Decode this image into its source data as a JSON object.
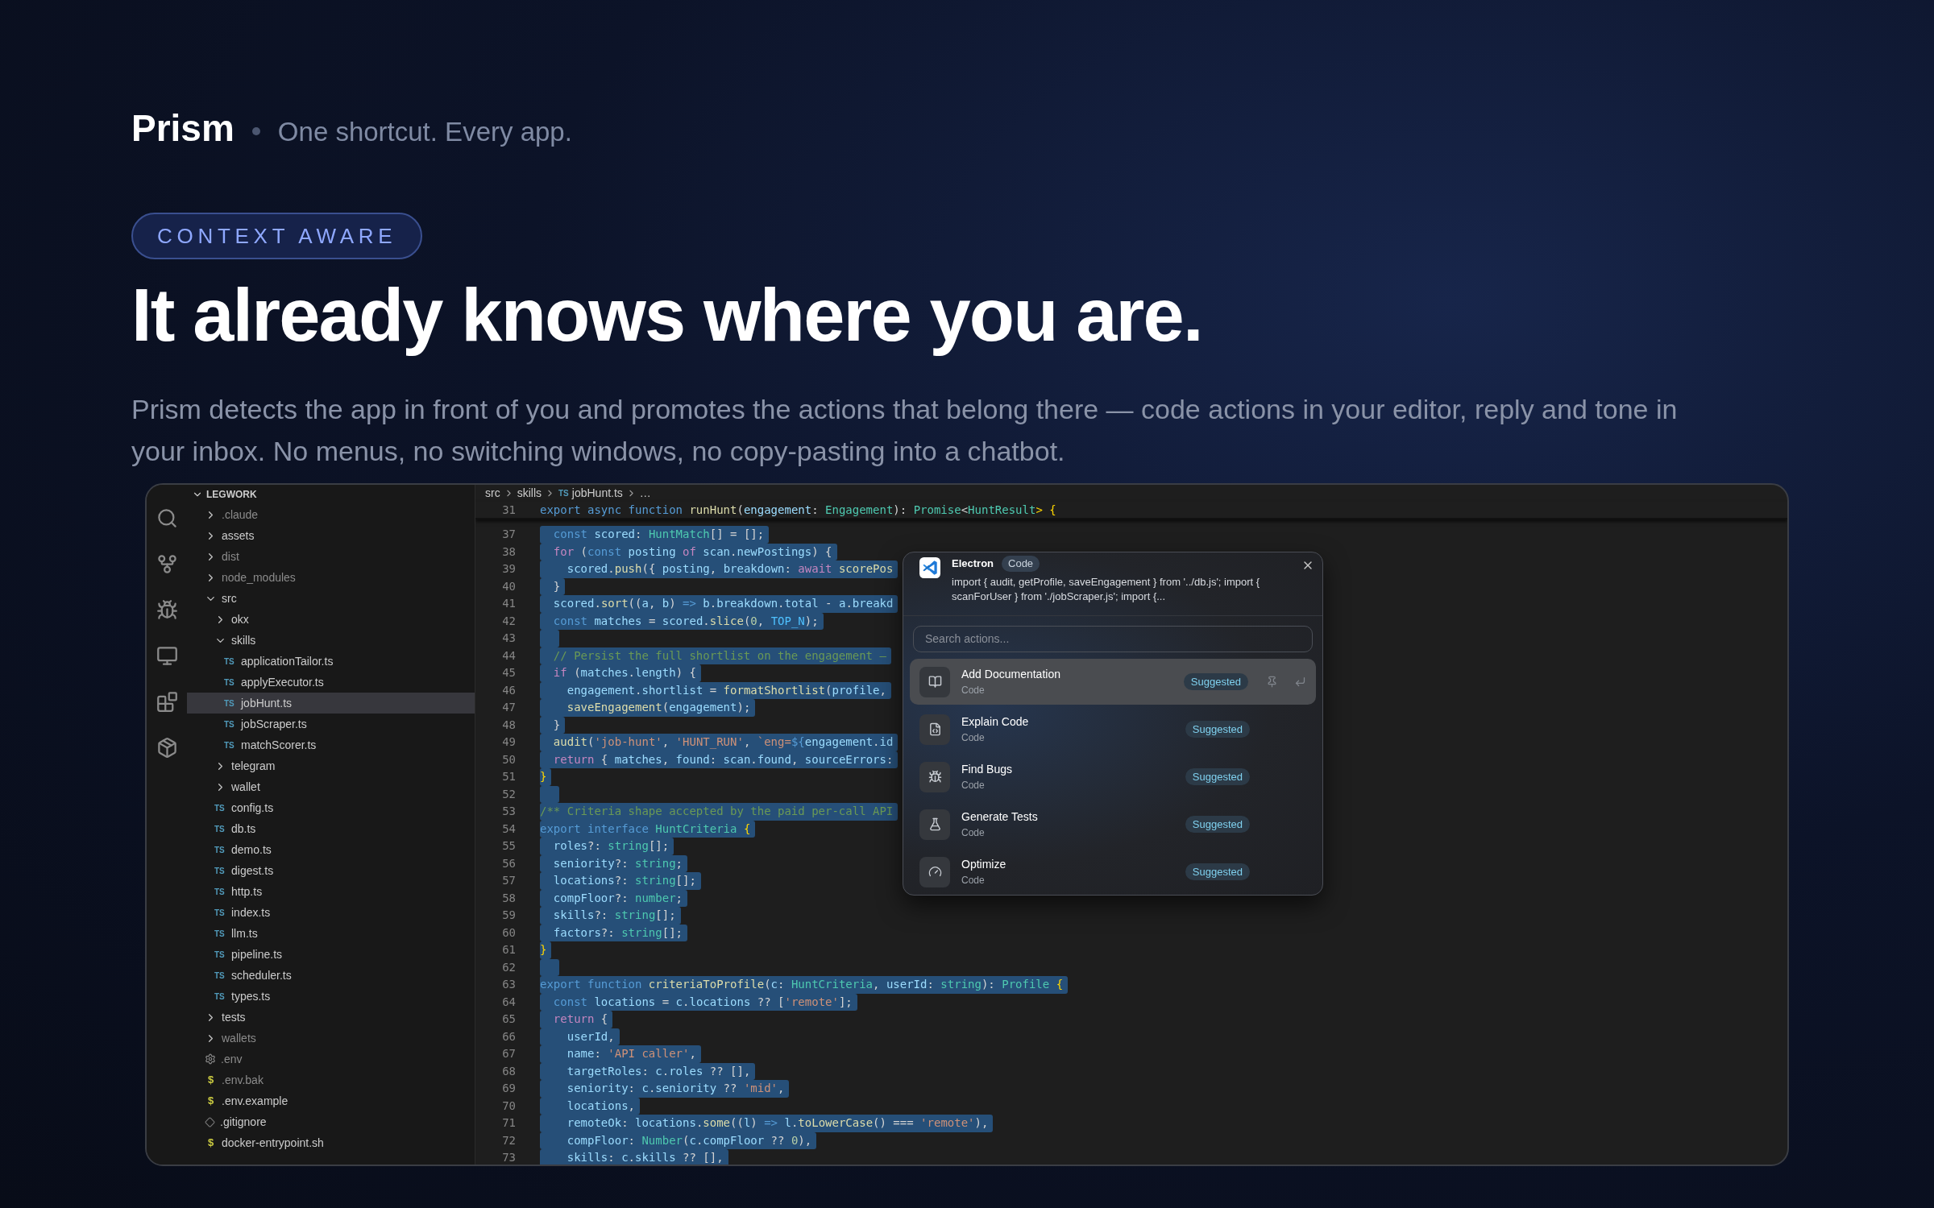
{
  "brand": {
    "name": "Prism",
    "tagline": "One shortcut. Every app."
  },
  "hero": {
    "eyebrow": "CONTEXT AWARE",
    "headline": "It already knows where you are.",
    "description": "Prism detects the app in front of you and promotes the actions that belong there — code actions in your editor, reply and tone in your inbox. No menus, no switching windows, no copy-pasting into a chatbot."
  },
  "editor": {
    "explorer": {
      "title": "LEGWORK",
      "expanded": true,
      "items": [
        {
          "name": ".claude",
          "kind": "folder",
          "expanded": false,
          "ignored": true,
          "selected": false
        },
        {
          "name": "assets",
          "kind": "folder",
          "expanded": false,
          "ignored": false,
          "selected": false
        },
        {
          "name": "dist",
          "kind": "folder",
          "expanded": false,
          "ignored": true,
          "selected": false
        },
        {
          "name": "node_modules",
          "kind": "folder",
          "expanded": false,
          "ignored": true,
          "selected": false
        },
        {
          "name": "src",
          "kind": "folder",
          "expanded": true,
          "ignored": false,
          "selected": false,
          "children": [
            {
              "name": "okx",
              "kind": "folder",
              "expanded": false,
              "ignored": false,
              "selected": false
            },
            {
              "name": "skills",
              "kind": "folder",
              "expanded": true,
              "ignored": false,
              "selected": false,
              "children": [
                {
                  "name": "applicationTailor.ts",
                  "kind": "ts",
                  "badge": "TS",
                  "ignored": false,
                  "selected": false
                },
                {
                  "name": "applyExecutor.ts",
                  "kind": "ts",
                  "badge": "TS",
                  "ignored": false,
                  "selected": false
                },
                {
                  "name": "jobHunt.ts",
                  "kind": "ts",
                  "badge": "TS",
                  "ignored": false,
                  "selected": true
                },
                {
                  "name": "jobScraper.ts",
                  "kind": "ts",
                  "badge": "TS",
                  "ignored": false,
                  "selected": false
                },
                {
                  "name": "matchScorer.ts",
                  "kind": "ts",
                  "badge": "TS",
                  "ignored": false,
                  "selected": false
                }
              ]
            },
            {
              "name": "telegram",
              "kind": "folder",
              "expanded": false,
              "ignored": false,
              "selected": false
            },
            {
              "name": "wallet",
              "kind": "folder",
              "expanded": false,
              "ignored": false,
              "selected": false
            },
            {
              "name": "config.ts",
              "kind": "ts",
              "badge": "TS",
              "ignored": false,
              "selected": false
            },
            {
              "name": "db.ts",
              "kind": "ts",
              "badge": "TS",
              "ignored": false,
              "selected": false
            },
            {
              "name": "demo.ts",
              "kind": "ts",
              "badge": "TS",
              "ignored": false,
              "selected": false
            },
            {
              "name": "digest.ts",
              "kind": "ts",
              "badge": "TS",
              "ignored": false,
              "selected": false
            },
            {
              "name": "http.ts",
              "kind": "ts",
              "badge": "TS",
              "ignored": false,
              "selected": false
            },
            {
              "name": "index.ts",
              "kind": "ts",
              "badge": "TS",
              "ignored": false,
              "selected": false
            },
            {
              "name": "llm.ts",
              "kind": "ts",
              "badge": "TS",
              "ignored": false,
              "selected": false
            },
            {
              "name": "pipeline.ts",
              "kind": "ts",
              "badge": "TS",
              "ignored": false,
              "selected": false
            },
            {
              "name": "scheduler.ts",
              "kind": "ts",
              "badge": "TS",
              "ignored": false,
              "selected": false
            },
            {
              "name": "types.ts",
              "kind": "ts",
              "badge": "TS",
              "ignored": false,
              "selected": false
            }
          ]
        },
        {
          "name": "tests",
          "kind": "folder",
          "expanded": false,
          "ignored": false,
          "selected": false
        },
        {
          "name": "wallets",
          "kind": "folder",
          "expanded": false,
          "ignored": true,
          "selected": false
        },
        {
          "name": ".env",
          "kind": "env",
          "ignored": true,
          "selected": false
        },
        {
          "name": ".env.bak",
          "kind": "shell",
          "badge": "$",
          "ignored": true,
          "selected": false
        },
        {
          "name": ".env.example",
          "kind": "shell",
          "badge": "$",
          "ignored": false,
          "selected": false
        },
        {
          "name": ".gitignore",
          "kind": "git",
          "ignored": false,
          "selected": false
        },
        {
          "name": "docker-entrypoint.sh",
          "kind": "shell",
          "badge": "$",
          "ignored": false,
          "selected": false
        }
      ]
    },
    "breadcrumbs": [
      {
        "text": "src",
        "kind": "folder"
      },
      {
        "text": "skills",
        "kind": "folder"
      },
      {
        "text": "jobHunt.ts",
        "kind": "ts",
        "badge": "TS"
      },
      {
        "text": "…",
        "kind": "more"
      }
    ],
    "sticky_line": {
      "number": "31",
      "tokens": [
        {
          "text": "export async function ",
          "kind": "kw"
        },
        {
          "text": "runHunt",
          "kind": "fn"
        },
        {
          "text": "(",
          "kind": "pl"
        },
        {
          "text": "engagement",
          "kind": "var"
        },
        {
          "text": ": ",
          "kind": "pl"
        },
        {
          "text": "Engagement",
          "kind": "type"
        },
        {
          "text": "): ",
          "kind": "pl"
        },
        {
          "text": "Promise",
          "kind": "type"
        },
        {
          "text": "<",
          "kind": "pl"
        },
        {
          "text": "HuntResult",
          "kind": "type"
        },
        {
          "text": "> {",
          "kind": "brace"
        }
      ]
    },
    "lines": [
      {
        "number": "37",
        "selected": true,
        "tokens": [
          {
            "text": "  const ",
            "kind": "kw"
          },
          {
            "text": "scored",
            "kind": "var"
          },
          {
            "text": ": ",
            "kind": "pl"
          },
          {
            "text": "HuntMatch",
            "kind": "type"
          },
          {
            "text": "[] = [];",
            "kind": "pl"
          }
        ]
      },
      {
        "number": "38",
        "selected": true,
        "tokens": [
          {
            "text": "  for ",
            "kind": "ctl"
          },
          {
            "text": "(",
            "kind": "pl"
          },
          {
            "text": "const ",
            "kind": "kw"
          },
          {
            "text": "posting",
            "kind": "var"
          },
          {
            "text": " of ",
            "kind": "ctl"
          },
          {
            "text": "scan",
            "kind": "var"
          },
          {
            "text": ".",
            "kind": "pl"
          },
          {
            "text": "newPostings",
            "kind": "var"
          },
          {
            "text": ") {",
            "kind": "pl"
          }
        ]
      },
      {
        "number": "39",
        "selected": true,
        "tokens": [
          {
            "text": "    scored",
            "kind": "var"
          },
          {
            "text": ".",
            "kind": "pl"
          },
          {
            "text": "push",
            "kind": "fn"
          },
          {
            "text": "({ ",
            "kind": "pl"
          },
          {
            "text": "posting",
            "kind": "var"
          },
          {
            "text": ", ",
            "kind": "pl"
          },
          {
            "text": "breakdown",
            "kind": "var"
          },
          {
            "text": ": ",
            "kind": "pl"
          },
          {
            "text": "await ",
            "kind": "ctl"
          },
          {
            "text": "scorePos",
            "kind": "fn"
          }
        ]
      },
      {
        "number": "40",
        "selected": true,
        "tokens": [
          {
            "text": "  }",
            "kind": "pl"
          }
        ]
      },
      {
        "number": "41",
        "selected": true,
        "tokens": [
          {
            "text": "  scored",
            "kind": "var"
          },
          {
            "text": ".",
            "kind": "pl"
          },
          {
            "text": "sort",
            "kind": "fn"
          },
          {
            "text": "((",
            "kind": "pl"
          },
          {
            "text": "a",
            "kind": "var"
          },
          {
            "text": ", ",
            "kind": "pl"
          },
          {
            "text": "b",
            "kind": "var"
          },
          {
            "text": ") ",
            "kind": "pl"
          },
          {
            "text": "=> ",
            "kind": "kw"
          },
          {
            "text": "b",
            "kind": "var"
          },
          {
            "text": ".",
            "kind": "pl"
          },
          {
            "text": "breakdown",
            "kind": "var"
          },
          {
            "text": ".",
            "kind": "pl"
          },
          {
            "text": "total",
            "kind": "var"
          },
          {
            "text": " - ",
            "kind": "pl"
          },
          {
            "text": "a",
            "kind": "var"
          },
          {
            "text": ".",
            "kind": "pl"
          },
          {
            "text": "breakd",
            "kind": "var"
          }
        ]
      },
      {
        "number": "42",
        "selected": true,
        "tokens": [
          {
            "text": "  const ",
            "kind": "kw"
          },
          {
            "text": "matches",
            "kind": "var"
          },
          {
            "text": " = ",
            "kind": "pl"
          },
          {
            "text": "scored",
            "kind": "var"
          },
          {
            "text": ".",
            "kind": "pl"
          },
          {
            "text": "slice",
            "kind": "fn"
          },
          {
            "text": "(",
            "kind": "pl"
          },
          {
            "text": "0",
            "kind": "num"
          },
          {
            "text": ", ",
            "kind": "pl"
          },
          {
            "text": "TOP_N",
            "kind": "const"
          },
          {
            "text": ");",
            "kind": "pl"
          }
        ]
      },
      {
        "number": "43",
        "selected": true
      },
      {
        "number": "44",
        "selected": true,
        "tokens": [
          {
            "text": "  // Persist the full shortlist on the engagement —",
            "kind": "com"
          }
        ]
      },
      {
        "number": "45",
        "selected": true,
        "tokens": [
          {
            "text": "  if ",
            "kind": "ctl"
          },
          {
            "text": "(",
            "kind": "pl"
          },
          {
            "text": "matches",
            "kind": "var"
          },
          {
            "text": ".",
            "kind": "pl"
          },
          {
            "text": "length",
            "kind": "var"
          },
          {
            "text": ") {",
            "kind": "pl"
          }
        ]
      },
      {
        "number": "46",
        "selected": true,
        "tokens": [
          {
            "text": "    engagement",
            "kind": "var"
          },
          {
            "text": ".",
            "kind": "pl"
          },
          {
            "text": "shortlist",
            "kind": "var"
          },
          {
            "text": " = ",
            "kind": "pl"
          },
          {
            "text": "formatShortlist",
            "kind": "fn"
          },
          {
            "text": "(",
            "kind": "pl"
          },
          {
            "text": "profile",
            "kind": "var"
          },
          {
            "text": ",",
            "kind": "pl"
          }
        ]
      },
      {
        "number": "47",
        "selected": true,
        "tokens": [
          {
            "text": "    saveEngagement",
            "kind": "fn"
          },
          {
            "text": "(",
            "kind": "pl"
          },
          {
            "text": "engagement",
            "kind": "var"
          },
          {
            "text": ");",
            "kind": "pl"
          }
        ]
      },
      {
        "number": "48",
        "selected": true,
        "tokens": [
          {
            "text": "  }",
            "kind": "pl"
          }
        ]
      },
      {
        "number": "49",
        "selected": true,
        "tokens": [
          {
            "text": "  audit",
            "kind": "fn"
          },
          {
            "text": "(",
            "kind": "pl"
          },
          {
            "text": "'job-hunt'",
            "kind": "str"
          },
          {
            "text": ", ",
            "kind": "pl"
          },
          {
            "text": "'HUNT_RUN'",
            "kind": "str"
          },
          {
            "text": ", ",
            "kind": "pl"
          },
          {
            "text": "`eng=",
            "kind": "str"
          },
          {
            "text": "${",
            "kind": "kw"
          },
          {
            "text": "engagement",
            "kind": "var"
          },
          {
            "text": ".",
            "kind": "pl"
          },
          {
            "text": "id",
            "kind": "var"
          }
        ]
      },
      {
        "number": "50",
        "selected": true,
        "tokens": [
          {
            "text": "  return ",
            "kind": "ctl"
          },
          {
            "text": "{ ",
            "kind": "pl"
          },
          {
            "text": "matches",
            "kind": "var"
          },
          {
            "text": ", ",
            "kind": "pl"
          },
          {
            "text": "found",
            "kind": "var"
          },
          {
            "text": ": ",
            "kind": "pl"
          },
          {
            "text": "scan",
            "kind": "var"
          },
          {
            "text": ".",
            "kind": "pl"
          },
          {
            "text": "found",
            "kind": "var"
          },
          {
            "text": ", ",
            "kind": "pl"
          },
          {
            "text": "sourceErrors",
            "kind": "var"
          },
          {
            "text": ":",
            "kind": "pl"
          }
        ]
      },
      {
        "number": "51",
        "selected": true,
        "tokens": [
          {
            "text": "}",
            "kind": "brace"
          }
        ]
      },
      {
        "number": "52",
        "selected": true
      },
      {
        "number": "53",
        "selected": true,
        "tokens": [
          {
            "text": "/** Criteria shape accepted by the paid per-call API",
            "kind": "com"
          }
        ]
      },
      {
        "number": "54",
        "selected": true,
        "tokens": [
          {
            "text": "export interface ",
            "kind": "kw"
          },
          {
            "text": "HuntCriteria",
            "kind": "type"
          },
          {
            "text": " {",
            "kind": "brace"
          }
        ]
      },
      {
        "number": "55",
        "selected": true,
        "tokens": [
          {
            "text": "  roles",
            "kind": "var"
          },
          {
            "text": "?: ",
            "kind": "pl"
          },
          {
            "text": "string",
            "kind": "type"
          },
          {
            "text": "[];",
            "kind": "pl"
          }
        ]
      },
      {
        "number": "56",
        "selected": true,
        "tokens": [
          {
            "text": "  seniority",
            "kind": "var"
          },
          {
            "text": "?: ",
            "kind": "pl"
          },
          {
            "text": "string",
            "kind": "type"
          },
          {
            "text": ";",
            "kind": "pl"
          }
        ]
      },
      {
        "number": "57",
        "selected": true,
        "tokens": [
          {
            "text": "  locations",
            "kind": "var"
          },
          {
            "text": "?: ",
            "kind": "pl"
          },
          {
            "text": "string",
            "kind": "type"
          },
          {
            "text": "[];",
            "kind": "pl"
          }
        ]
      },
      {
        "number": "58",
        "selected": true,
        "tokens": [
          {
            "text": "  compFloor",
            "kind": "var"
          },
          {
            "text": "?: ",
            "kind": "pl"
          },
          {
            "text": "number",
            "kind": "type"
          },
          {
            "text": ";",
            "kind": "pl"
          }
        ]
      },
      {
        "number": "59",
        "selected": true,
        "tokens": [
          {
            "text": "  skills",
            "kind": "var"
          },
          {
            "text": "?: ",
            "kind": "pl"
          },
          {
            "text": "string",
            "kind": "type"
          },
          {
            "text": "[];",
            "kind": "pl"
          }
        ]
      },
      {
        "number": "60",
        "selected": true,
        "tokens": [
          {
            "text": "  factors",
            "kind": "var"
          },
          {
            "text": "?: ",
            "kind": "pl"
          },
          {
            "text": "string",
            "kind": "type"
          },
          {
            "text": "[];",
            "kind": "pl"
          }
        ]
      },
      {
        "number": "61",
        "selected": true,
        "tokens": [
          {
            "text": "}",
            "kind": "brace"
          }
        ]
      },
      {
        "number": "62",
        "selected": true
      },
      {
        "number": "63",
        "selected": true,
        "tokens": [
          {
            "text": "export function ",
            "kind": "kw"
          },
          {
            "text": "criteriaToProfile",
            "kind": "fn"
          },
          {
            "text": "(",
            "kind": "pl"
          },
          {
            "text": "c",
            "kind": "var"
          },
          {
            "text": ": ",
            "kind": "pl"
          },
          {
            "text": "HuntCriteria",
            "kind": "type"
          },
          {
            "text": ", ",
            "kind": "pl"
          },
          {
            "text": "userId",
            "kind": "var"
          },
          {
            "text": ": ",
            "kind": "pl"
          },
          {
            "text": "string",
            "kind": "type"
          },
          {
            "text": "): ",
            "kind": "pl"
          },
          {
            "text": "Profile",
            "kind": "type"
          },
          {
            "text": " {",
            "kind": "brace"
          }
        ]
      },
      {
        "number": "64",
        "selected": true,
        "tokens": [
          {
            "text": "  const ",
            "kind": "kw"
          },
          {
            "text": "locations",
            "kind": "var"
          },
          {
            "text": " = ",
            "kind": "pl"
          },
          {
            "text": "c",
            "kind": "var"
          },
          {
            "text": ".",
            "kind": "pl"
          },
          {
            "text": "locations",
            "kind": "var"
          },
          {
            "text": " ?? [",
            "kind": "pl"
          },
          {
            "text": "'remote'",
            "kind": "str"
          },
          {
            "text": "];",
            "kind": "pl"
          }
        ]
      },
      {
        "number": "65",
        "selected": true,
        "tokens": [
          {
            "text": "  return ",
            "kind": "ctl"
          },
          {
            "text": "{",
            "kind": "pl"
          }
        ]
      },
      {
        "number": "66",
        "selected": true,
        "tokens": [
          {
            "text": "    userId",
            "kind": "var"
          },
          {
            "text": ",",
            "kind": "pl"
          }
        ]
      },
      {
        "number": "67",
        "selected": true,
        "tokens": [
          {
            "text": "    name",
            "kind": "var"
          },
          {
            "text": ": ",
            "kind": "pl"
          },
          {
            "text": "'API caller'",
            "kind": "str"
          },
          {
            "text": ",",
            "kind": "pl"
          }
        ]
      },
      {
        "number": "68",
        "selected": true,
        "tokens": [
          {
            "text": "    targetRoles",
            "kind": "var"
          },
          {
            "text": ": ",
            "kind": "pl"
          },
          {
            "text": "c",
            "kind": "var"
          },
          {
            "text": ".",
            "kind": "pl"
          },
          {
            "text": "roles",
            "kind": "var"
          },
          {
            "text": " ?? [],",
            "kind": "pl"
          }
        ]
      },
      {
        "number": "69",
        "selected": true,
        "tokens": [
          {
            "text": "    seniority",
            "kind": "var"
          },
          {
            "text": ": ",
            "kind": "pl"
          },
          {
            "text": "c",
            "kind": "var"
          },
          {
            "text": ".",
            "kind": "pl"
          },
          {
            "text": "seniority",
            "kind": "var"
          },
          {
            "text": " ?? ",
            "kind": "pl"
          },
          {
            "text": "'mid'",
            "kind": "str"
          },
          {
            "text": ",",
            "kind": "pl"
          }
        ]
      },
      {
        "number": "70",
        "selected": true,
        "tokens": [
          {
            "text": "    locations",
            "kind": "var"
          },
          {
            "text": ",",
            "kind": "pl"
          }
        ]
      },
      {
        "number": "71",
        "selected": true,
        "tokens": [
          {
            "text": "    remoteOk",
            "kind": "var"
          },
          {
            "text": ": ",
            "kind": "pl"
          },
          {
            "text": "locations",
            "kind": "var"
          },
          {
            "text": ".",
            "kind": "pl"
          },
          {
            "text": "some",
            "kind": "fn"
          },
          {
            "text": "((",
            "kind": "pl"
          },
          {
            "text": "l",
            "kind": "var"
          },
          {
            "text": ") ",
            "kind": "pl"
          },
          {
            "text": "=> ",
            "kind": "kw"
          },
          {
            "text": "l",
            "kind": "var"
          },
          {
            "text": ".",
            "kind": "pl"
          },
          {
            "text": "toLowerCase",
            "kind": "fn"
          },
          {
            "text": "() === ",
            "kind": "pl"
          },
          {
            "text": "'remote'",
            "kind": "str"
          },
          {
            "text": "),",
            "kind": "pl"
          }
        ]
      },
      {
        "number": "72",
        "selected": true,
        "tokens": [
          {
            "text": "    compFloor",
            "kind": "var"
          },
          {
            "text": ": ",
            "kind": "pl"
          },
          {
            "text": "Number",
            "kind": "type"
          },
          {
            "text": "(",
            "kind": "pl"
          },
          {
            "text": "c",
            "kind": "var"
          },
          {
            "text": ".",
            "kind": "pl"
          },
          {
            "text": "compFloor",
            "kind": "var"
          },
          {
            "text": " ?? ",
            "kind": "pl"
          },
          {
            "text": "0",
            "kind": "num"
          },
          {
            "text": "),",
            "kind": "pl"
          }
        ]
      },
      {
        "number": "73",
        "selected": true,
        "tokens": [
          {
            "text": "    skills",
            "kind": "var"
          },
          {
            "text": ": ",
            "kind": "pl"
          },
          {
            "text": "c",
            "kind": "var"
          },
          {
            "text": ".",
            "kind": "pl"
          },
          {
            "text": "skills",
            "kind": "var"
          },
          {
            "text": " ?? [],",
            "kind": "pl"
          }
        ]
      }
    ]
  },
  "palette": {
    "app": "Electron",
    "app_tag": "Code",
    "context": "import { audit, getProfile, saveEngagement } from '../db.js'; import { scanForUser } from './jobScraper.js'; import {...",
    "search": {
      "placeholder": "Search actions..."
    },
    "actions": [
      {
        "title": "Add Documentation",
        "category": "Code",
        "badge": "Suggested",
        "kind": "docs",
        "selected": true
      },
      {
        "title": "Explain Code",
        "category": "Code",
        "badge": "Suggested",
        "kind": "explain",
        "selected": false
      },
      {
        "title": "Find Bugs",
        "category": "Code",
        "badge": "Suggested",
        "kind": "bugs",
        "selected": false
      },
      {
        "title": "Generate Tests",
        "category": "Code",
        "badge": "Suggested",
        "kind": "tests",
        "selected": false
      },
      {
        "title": "Optimize",
        "category": "Code",
        "badge": "Suggested",
        "kind": "optimize",
        "selected": false
      }
    ]
  }
}
